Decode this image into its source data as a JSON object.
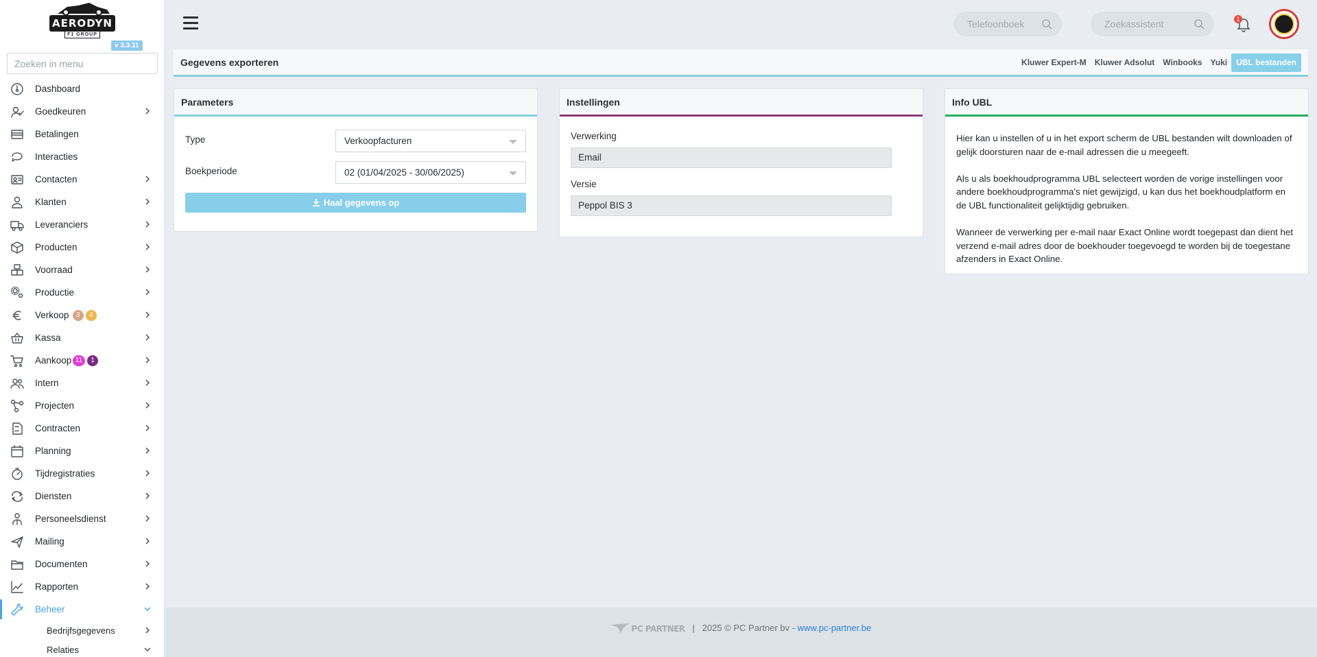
{
  "brand": {
    "logo_text": "AERODYN",
    "logo_sub": "F1 GROUP",
    "version": "v 3.3.11"
  },
  "sidebar": {
    "search_placeholder": "Zoeken in menu",
    "items": [
      {
        "label": "Dashboard",
        "icon": "dashboard-icon",
        "chevron": false
      },
      {
        "label": "Goedkeuren",
        "icon": "user-check-icon",
        "chevron": true
      },
      {
        "label": "Betalingen",
        "icon": "credit-card-icon",
        "chevron": false
      },
      {
        "label": "Interacties",
        "icon": "chat-icon",
        "chevron": false
      },
      {
        "label": "Contacten",
        "icon": "contact-card-icon",
        "chevron": true
      },
      {
        "label": "Klanten",
        "icon": "customer-icon",
        "chevron": true
      },
      {
        "label": "Leveranciers",
        "icon": "truck-icon",
        "chevron": true
      },
      {
        "label": "Producten",
        "icon": "box-icon",
        "chevron": true
      },
      {
        "label": "Voorraad",
        "icon": "stock-boxes-icon",
        "chevron": true
      },
      {
        "label": "Productie",
        "icon": "gears-icon",
        "chevron": true
      },
      {
        "label": "Verkoop",
        "icon": "euro-icon",
        "chevron": true,
        "badges": [
          {
            "text": "3",
            "color": "#d9a487"
          },
          {
            "text": "4",
            "color": "#f0b64a"
          }
        ]
      },
      {
        "label": "Kassa",
        "icon": "basket-icon",
        "chevron": true
      },
      {
        "label": "Aankoop",
        "icon": "cart-icon",
        "chevron": true,
        "badges": [
          {
            "text": "11",
            "color": "#e23fd6"
          },
          {
            "text": "1",
            "color": "#7a2a86"
          }
        ]
      },
      {
        "label": "Intern",
        "icon": "users-icon",
        "chevron": true
      },
      {
        "label": "Projecten",
        "icon": "project-nodes-icon",
        "chevron": true
      },
      {
        "label": "Contracten",
        "icon": "contract-icon",
        "chevron": true
      },
      {
        "label": "Planning",
        "icon": "calendar-icon",
        "chevron": true
      },
      {
        "label": "Tijdregistraties",
        "icon": "timer-icon",
        "chevron": true
      },
      {
        "label": "Diensten",
        "icon": "repeat-icon",
        "chevron": true
      },
      {
        "label": "Personeelsdienst",
        "icon": "staff-icon",
        "chevron": true
      },
      {
        "label": "Mailing",
        "icon": "paper-plane-icon",
        "chevron": true
      },
      {
        "label": "Documenten",
        "icon": "folder-icon",
        "chevron": true
      },
      {
        "label": "Rapporten",
        "icon": "chart-line-icon",
        "chevron": true
      },
      {
        "label": "Beheer",
        "icon": "wrench-icon",
        "chevron": true,
        "active": true,
        "expanded": true
      }
    ],
    "sub_items": [
      {
        "label": "Bedrijfsgegevens"
      },
      {
        "label": "Relaties"
      }
    ]
  },
  "topbar": {
    "search1_placeholder": "Telefoonboek",
    "search2_placeholder": "Zoekassistent",
    "notification_count": "1"
  },
  "page": {
    "title": "Gegevens exporteren",
    "tabs": [
      {
        "label": "Kluwer Expert-M",
        "active": false
      },
      {
        "label": "Kluwer Adsolut",
        "active": false
      },
      {
        "label": "Winbooks",
        "active": false
      },
      {
        "label": "Yuki",
        "active": false
      },
      {
        "label": "UBL bestanden",
        "active": true
      }
    ]
  },
  "parameters": {
    "title": "Parameters",
    "accent": "#87d0dc",
    "type_label": "Type",
    "type_value": "Verkoopfacturen",
    "period_label": "Boekperiode",
    "period_value": "02 (01/04/2025 - 30/06/2025)",
    "button_label": "Haal gegevens op"
  },
  "settings": {
    "title": "Instellingen",
    "accent": "#8e3b7a",
    "verwerking_label": "Verwerking",
    "verwerking_value": "Email",
    "versie_label": "Versie",
    "versie_value": "Peppol BIS 3"
  },
  "info": {
    "title": "Info UBL",
    "accent": "#27ae60",
    "paragraphs": [
      "Hier kan u instellen of u in het export scherm de UBL bestanden wilt downloaden of gelijk doorsturen naar de e-mail adressen die u meegeeft.",
      "Als u als boekhoudprogramma UBL selecteert worden de vorige instellingen voor andere boekhoudprogramma's niet gewijzigd, u kan dus het boekhoudplatform en de UBL functionaliteit gelijktijdig gebruiken.",
      "Wanneer de verwerking per e-mail naar Exact Online wordt toegepast dan dient het verzend e-mail adres door de boekhouder toegevoegd te worden bij de toegestane afzenders in Exact Online."
    ]
  },
  "footer": {
    "logo_text": "PC PARTNER",
    "separator": "|",
    "copyright": "2025 © PC Partner bv -",
    "link_text": "www.pc-partner.be"
  }
}
